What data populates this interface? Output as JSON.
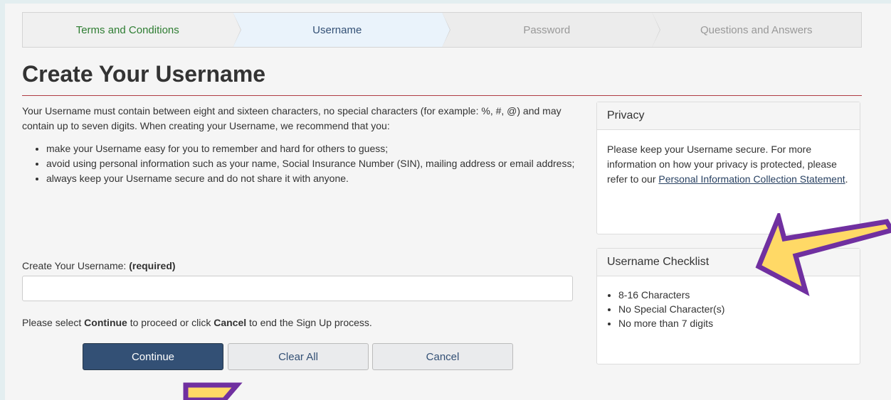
{
  "steps": [
    {
      "label": "Terms and Conditions",
      "state": "done"
    },
    {
      "label": "Username",
      "state": "active"
    },
    {
      "label": "Password",
      "state": "pending"
    },
    {
      "label": "Questions and Answers",
      "state": "pending"
    }
  ],
  "page_title": "Create Your Username",
  "intro": {
    "paragraph": "Your Username must contain between eight and sixteen characters, no special characters (for example: %, #, @) and may contain up to seven digits. When creating your Username, we recommend that you:",
    "bullets": [
      "make your Username easy for you to remember and hard for others to guess;",
      "avoid using personal information such as your name, Social Insurance Number (SIN), mailing address or email address;",
      "always keep your Username secure and do not share it with anyone."
    ]
  },
  "form": {
    "label": "Create Your Username:",
    "required": "(required)",
    "value": "",
    "proceed_before": "Please select ",
    "proceed_continue": "Continue",
    "proceed_middle": " to proceed or click ",
    "proceed_cancel": "Cancel",
    "proceed_after": " to end the Sign Up process."
  },
  "buttons": {
    "continue": "Continue",
    "clear_all": "Clear All",
    "cancel": "Cancel"
  },
  "privacy": {
    "title": "Privacy",
    "text_before": "Please keep your Username secure. For more information on how your privacy is protected, please refer to our ",
    "link": "Personal Information Collection Statement",
    "text_after": "."
  },
  "checklist": {
    "title": "Username Checklist",
    "items": [
      "8-16 Characters",
      "No Special Character(s)",
      "No more than 7 digits"
    ]
  },
  "colors": {
    "primary_button": "#335075",
    "heading_rule": "#af3c43",
    "arrow_fill": "#ffd966",
    "arrow_stroke": "#7030a0"
  }
}
